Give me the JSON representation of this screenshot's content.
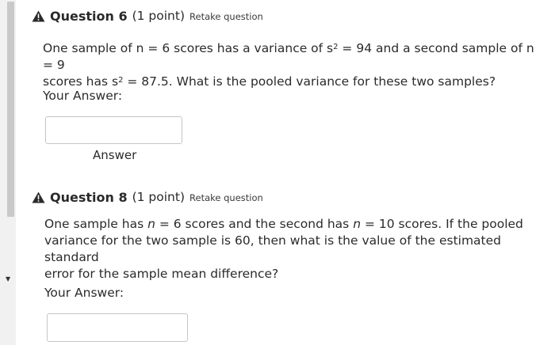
{
  "q6": {
    "title": "Question 6",
    "points": "(1 point)",
    "retake": "Retake question",
    "text": {
      "l1_a": "One sample of n = ",
      "l1_n1": "6",
      "l1_b": " scores has a variance of s",
      "l1_sup1": "2",
      "l1_c": " = 94 and a second sample of n = 9",
      "l2_a": "scores has s",
      "l2_sup": "2",
      "l2_b": " = 87.5. What is the pooled variance for these two samples?"
    },
    "your_answer": "Your Answer:",
    "input_value": "",
    "answer_tip": "Answer"
  },
  "q8": {
    "title": "Question 8",
    "points": "(1 point)",
    "retake": "Retake question",
    "text": {
      "l1_a": "One sample has ",
      "l1_n": "n",
      "l1_b": " = 6 scores and the second has ",
      "l1_n2": "n",
      "l1_c": " = 10 scores. If the pooled",
      "l2": "variance for the two sample is 60, then what is the value of the estimated standard",
      "l3": "error for the sample mean difference?"
    },
    "your_answer": "Your Answer:",
    "input_value": ""
  },
  "colors": {
    "text": "#2b2b2b",
    "warning_icon": "#2a2a2a",
    "input_border": "#c6c6c6"
  },
  "icons": [
    "warning-icon",
    "scroll-down-arrow-icon"
  ]
}
